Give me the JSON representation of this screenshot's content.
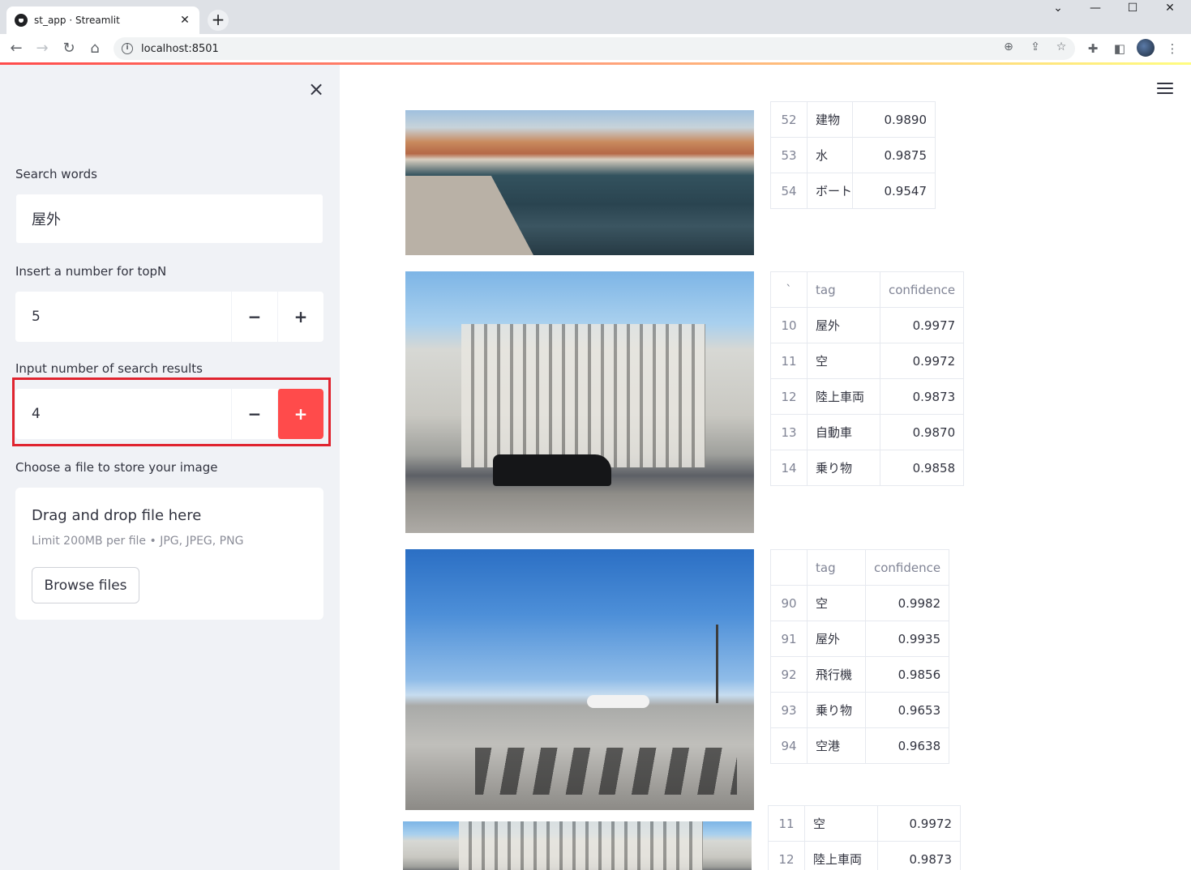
{
  "browser": {
    "tab_title": "st_app · Streamlit",
    "url": "localhost:8501"
  },
  "sidebar": {
    "search_label": "Search words",
    "search_value": "屋外",
    "topn_label": "Insert a number for topN",
    "topn_value": "5",
    "results_label": "Input number of search results",
    "results_value": "4",
    "minus": "−",
    "plus": "+",
    "file_label": "Choose a file to store your image",
    "drag_text": "Drag and drop file here",
    "limit_text": "Limit 200MB per file • JPG, JPEG, PNG",
    "browse_label": "Browse files"
  },
  "colors": {
    "accent": "#ff4b4b",
    "highlight": "#e0242f",
    "sidebar_bg": "#f0f2f6"
  },
  "results": [
    {
      "image": "venice-canal",
      "header": null,
      "rows": [
        {
          "idx": "52",
          "tag": "建物",
          "conf": "0.9890"
        },
        {
          "idx": "53",
          "tag": "水",
          "conf": "0.9875"
        },
        {
          "idx": "54",
          "tag": "ボート",
          "conf": "0.9547"
        }
      ]
    },
    {
      "image": "vittoriano-monument",
      "header": {
        "index": "`",
        "tag": "tag",
        "confidence": "confidence"
      },
      "rows": [
        {
          "idx": "10",
          "tag": "屋外",
          "conf": "0.9977"
        },
        {
          "idx": "11",
          "tag": "空",
          "conf": "0.9972"
        },
        {
          "idx": "12",
          "tag": "陸上車両",
          "conf": "0.9873"
        },
        {
          "idx": "13",
          "tag": "自動車",
          "conf": "0.9870"
        },
        {
          "idx": "14",
          "tag": "乗り物",
          "conf": "0.9858"
        }
      ]
    },
    {
      "image": "airport-apron",
      "header": {
        "index": "",
        "tag": "tag",
        "confidence": "confidence"
      },
      "rows": [
        {
          "idx": "90",
          "tag": "空",
          "conf": "0.9982"
        },
        {
          "idx": "91",
          "tag": "屋外",
          "conf": "0.9935"
        },
        {
          "idx": "92",
          "tag": "飛行機",
          "conf": "0.9856"
        },
        {
          "idx": "93",
          "tag": "乗り物",
          "conf": "0.9653"
        },
        {
          "idx": "94",
          "tag": "空港",
          "conf": "0.9638"
        }
      ]
    },
    {
      "image": "vittoriano-monument",
      "header": null,
      "rows": [
        {
          "idx": "11",
          "tag": "空",
          "conf": "0.9972"
        },
        {
          "idx": "12",
          "tag": "陸上車両",
          "conf": "0.9873"
        }
      ]
    }
  ]
}
